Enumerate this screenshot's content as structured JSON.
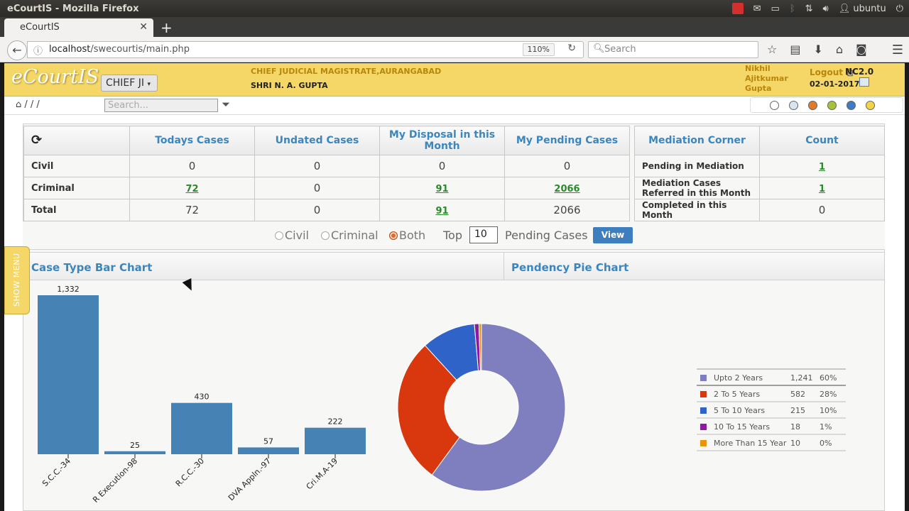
{
  "window_title": "eCourtIS - Mozilla Firefox",
  "tray": {
    "user": "ubuntu"
  },
  "browser": {
    "tab_title": "eCourtIS",
    "url_host": "localhost",
    "url_path": "/swecourtis/main.php",
    "zoom": "110%",
    "search_placeholder": "Search"
  },
  "header": {
    "logo": "eCourtIS",
    "court_select": "CHIEF JI",
    "court_name": "CHIEF JUDICIAL MAGISTRATE,AURANGABAD",
    "judge": "SHRI N. A. GUPTA",
    "user": "Nikhil Ajitkumar Gupta",
    "logout": "Logout",
    "code": "NC2.0",
    "date": "02-01-2017"
  },
  "toolbar": {
    "breadcrumb": "/ / /",
    "search_placeholder": "Search...",
    "theme_colors": [
      "#ffffff",
      "#d8e4ef",
      "#e07a28",
      "#a6c23a",
      "#3b7cc4",
      "#f2d34a"
    ]
  },
  "stats_table": {
    "headers": [
      "Todays Cases",
      "Undated Cases",
      "My Disposal in this Month",
      "My Pending Cases"
    ],
    "rows": [
      {
        "label": "Civil",
        "values": [
          "0",
          "0",
          "0",
          "0"
        ],
        "links": [
          false,
          false,
          false,
          false
        ]
      },
      {
        "label": "Criminal",
        "values": [
          "72",
          "0",
          "91",
          "2066"
        ],
        "links": [
          true,
          false,
          true,
          true
        ]
      },
      {
        "label": "Total",
        "values": [
          "72",
          "0",
          "91",
          "2066"
        ],
        "links": [
          false,
          false,
          true,
          false
        ]
      }
    ]
  },
  "mediation_table": {
    "headers": [
      "Mediation Corner",
      "Count"
    ],
    "rows": [
      {
        "label": "Pending in Mediation",
        "value": "1",
        "link": true
      },
      {
        "label": "Mediation Cases Referred in this Month",
        "value": "1",
        "link": true
      },
      {
        "label": "Completed in this Month",
        "value": "0",
        "link": false
      }
    ]
  },
  "filters": {
    "options": [
      "Civil",
      "Criminal",
      "Both"
    ],
    "selected": "Both",
    "top_label": "Top",
    "top_value": "10",
    "pending_label": "Pending Cases",
    "view_button": "View"
  },
  "show_menu": "SHOW MENU",
  "charts": {
    "bar_title": "Case Type Bar Chart",
    "pie_title": "Pendency Pie Chart"
  },
  "chart_data": [
    {
      "type": "bar",
      "title": "Case Type Bar Chart",
      "categories": [
        "S.C.C.-34",
        "R Execution-98",
        "R.C.C.-30",
        "DVA Appln.-97",
        "Cri.M.A-19"
      ],
      "values": [
        1332,
        25,
        430,
        57,
        222
      ],
      "value_labels": [
        "1,332",
        "25",
        "430",
        "57",
        "222"
      ],
      "color": "#4682b4"
    },
    {
      "type": "pie",
      "title": "Pendency Pie Chart",
      "donut": true,
      "labels": [
        "Upto 2 Years",
        "2 To 5 Years",
        "5 To 10 Years",
        "10 To 15 Years",
        "More Than 15 Year"
      ],
      "values": [
        1241,
        582,
        215,
        18,
        10
      ],
      "value_labels": [
        "1,241",
        "582",
        "215",
        "18",
        "10"
      ],
      "percents": [
        "60%",
        "28%",
        "10%",
        "1%",
        "0%"
      ],
      "colors": [
        "#7f7fbf",
        "#d9380e",
        "#2f63c8",
        "#8e1aa4",
        "#e8940f"
      ],
      "legend_position": "right"
    }
  ]
}
